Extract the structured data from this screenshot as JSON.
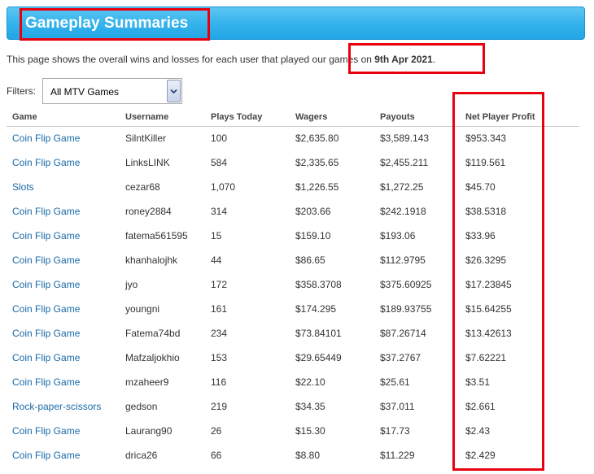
{
  "header": {
    "title": "Gameplay Summaries"
  },
  "intro": {
    "text_before": "This page shows the overall wins and losses for each user that played our games on ",
    "date": "9th Apr 2021",
    "text_after": "."
  },
  "filters": {
    "label": "Filters:",
    "selected": "All MTV Games"
  },
  "table": {
    "columns": [
      "Game",
      "Username",
      "Plays Today",
      "Wagers",
      "Payouts",
      "Net Player Profit"
    ],
    "rows": [
      [
        "Coin Flip Game",
        "SilntKiller",
        "100",
        "$2,635.80",
        "$3,589.143",
        "$953.343"
      ],
      [
        "Coin Flip Game",
        "LinksLINK",
        "584",
        "$2,335.65",
        "$2,455.211",
        "$119.561"
      ],
      [
        "Slots",
        "cezar68",
        "1,070",
        "$1,226.55",
        "$1,272.25",
        "$45.70"
      ],
      [
        "Coin Flip Game",
        "roney2884",
        "314",
        "$203.66",
        "$242.1918",
        "$38.5318"
      ],
      [
        "Coin Flip Game",
        "fatema561595",
        "15",
        "$159.10",
        "$193.06",
        "$33.96"
      ],
      [
        "Coin Flip Game",
        "khanhalojhk",
        "44",
        "$86.65",
        "$112.9795",
        "$26.3295"
      ],
      [
        "Coin Flip Game",
        "jyo",
        "172",
        "$358.3708",
        "$375.60925",
        "$17.23845"
      ],
      [
        "Coin Flip Game",
        "youngni",
        "161",
        "$174.295",
        "$189.93755",
        "$15.64255"
      ],
      [
        "Coin Flip Game",
        "Fatema74bd",
        "234",
        "$73.84101",
        "$87.26714",
        "$13.42613"
      ],
      [
        "Coin Flip Game",
        "Mafzaljokhio",
        "153",
        "$29.65449",
        "$37.2767",
        "$7.62221"
      ],
      [
        "Coin Flip Game",
        "mzaheer9",
        "116",
        "$22.10",
        "$25.61",
        "$3.51"
      ],
      [
        "Rock-paper-scissors",
        "gedson",
        "219",
        "$34.35",
        "$37.011",
        "$2.661"
      ],
      [
        "Coin Flip Game",
        "Laurang90",
        "26",
        "$15.30",
        "$17.73",
        "$2.43"
      ],
      [
        "Coin Flip Game",
        "drica26",
        "66",
        "$8.80",
        "$11.229",
        "$2.429"
      ]
    ]
  },
  "colors": {
    "title_bar": "#33b2ec",
    "link": "#1a6aa8",
    "highlight": "#e8000f"
  },
  "icons": {
    "select_arrow": "chevron-down-icon"
  }
}
